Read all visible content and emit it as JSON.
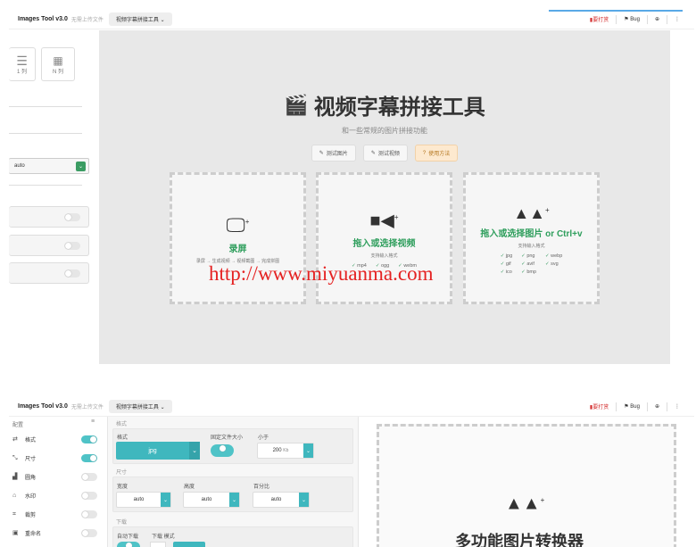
{
  "app": {
    "brand": "Images Tool v3.0",
    "hint": "无需上传文件",
    "tool_select": "视频字幕拼接工具 ⌄",
    "donate": "要打赏",
    "bug": "Bug"
  },
  "top_sidebar": {
    "col1_label": "1 列",
    "coln_label": "N 列",
    "select_value": "auto"
  },
  "hero": {
    "title": "视频字幕拼接工具",
    "subtitle": "和一些常规的图片拼接功能",
    "buttons": [
      "测试图片",
      "测试视频",
      "使用方法"
    ]
  },
  "drops": {
    "record": {
      "title": "录屏",
      "desc": "录屏 → 生成视频 → 视频截图 → 完成拼图"
    },
    "video": {
      "title": "拖入或选择视频",
      "desc": "支持输入格式",
      "formats": [
        "mp4",
        "ogg",
        "webm"
      ]
    },
    "image": {
      "title": "拖入或选择图片 or Ctrl+v",
      "desc": "支持输入格式",
      "formats": [
        "jpg",
        "png",
        "webp",
        "gif",
        "avif",
        "svg",
        "ico",
        "bmp"
      ]
    }
  },
  "watermark": "http://www.miyuanma.com",
  "bottom": {
    "brand": "Images Tool v3.0",
    "hint": "无需上传文件",
    "tool_select": "视频字幕拼接工具 ⌄",
    "donate": "要打赏",
    "bug": "Bug",
    "config_label": "配置",
    "sidebar_items": [
      {
        "label": "格式",
        "on": true
      },
      {
        "label": "尺寸",
        "on": true
      },
      {
        "label": "圆角",
        "on": false
      },
      {
        "label": "水印",
        "on": false
      },
      {
        "label": "裁剪",
        "on": false
      },
      {
        "label": "重命名",
        "on": false
      }
    ],
    "format_section": "格式",
    "format_label": "格式",
    "format_value": "jpg",
    "fixed_size_label": "固定文件大小",
    "less_than_label": "小于",
    "size_value": "200",
    "size_unit": "Kb",
    "size_section": "尺寸",
    "width_label": "宽度",
    "height_label": "高度",
    "percent_label": "百分比",
    "width_value": "auto",
    "height_value": "auto",
    "percent_value": "auto",
    "download_section": "下载",
    "auto_download_label": "自动下载",
    "download_mode_label": "下载 模式",
    "converter_title": "多功能图片转换器"
  },
  "colors": {
    "accent_green": "#2e9e5c",
    "teal": "#3fb7be",
    "donate_red": "#d43030",
    "watermark_red": "#e52222"
  }
}
